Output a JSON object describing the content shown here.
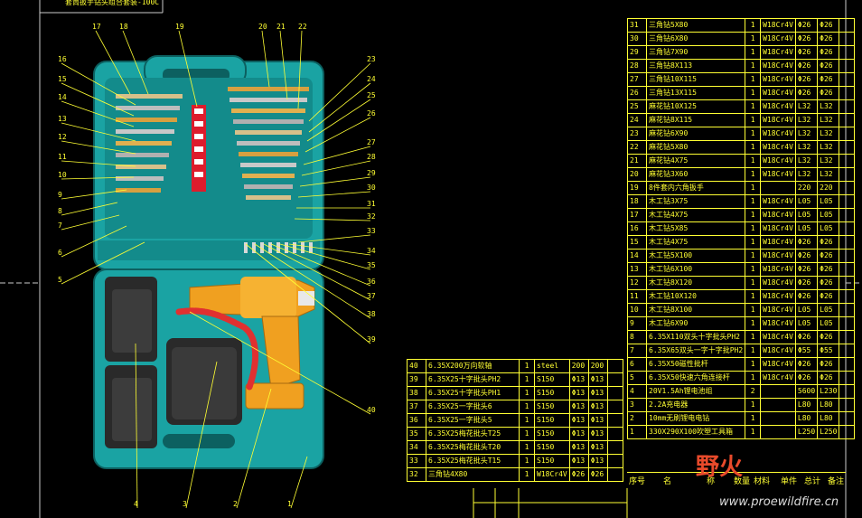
{
  "drawing_title_fragment": "套筒扳手钻头组合套装-100C",
  "callout_numbers": [
    "1",
    "2",
    "3",
    "4",
    "5",
    "6",
    "7",
    "8",
    "9",
    "10",
    "11",
    "12",
    "13",
    "14",
    "15",
    "16",
    "17",
    "18",
    "19",
    "20",
    "21",
    "22",
    "23",
    "24",
    "25",
    "26",
    "27",
    "28",
    "29",
    "30",
    "31",
    "32",
    "33",
    "34",
    "35",
    "36",
    "37",
    "38",
    "39",
    "40"
  ],
  "bom_right": [
    [
      "31",
      "三角钻5X80",
      "1",
      "W18Cr4V",
      "Φ26",
      "Φ26",
      ""
    ],
    [
      "30",
      "三角钻6X80",
      "1",
      "W18Cr4V",
      "Φ26",
      "Φ26",
      ""
    ],
    [
      "29",
      "三角钻7X90",
      "1",
      "W18Cr4V",
      "Φ26",
      "Φ26",
      ""
    ],
    [
      "28",
      "三角钻8X113",
      "1",
      "W18Cr4V",
      "Φ26",
      "Φ26",
      ""
    ],
    [
      "27",
      "三角钻10X115",
      "1",
      "W18Cr4V",
      "Φ26",
      "Φ26",
      ""
    ],
    [
      "26",
      "三角钻13X115",
      "1",
      "W18Cr4V",
      "Φ26",
      "Φ26",
      ""
    ],
    [
      "25",
      "麻花钻10X125",
      "1",
      "W18Cr4V",
      "L32",
      "L32",
      ""
    ],
    [
      "24",
      "麻花钻8X115",
      "1",
      "W18Cr4V",
      "L32",
      "L32",
      ""
    ],
    [
      "23",
      "麻花钻6X90",
      "1",
      "W18Cr4V",
      "L32",
      "L32",
      ""
    ],
    [
      "22",
      "麻花钻5X80",
      "1",
      "W18Cr4V",
      "L32",
      "L32",
      ""
    ],
    [
      "21",
      "麻花钻4X75",
      "1",
      "W18Cr4V",
      "L32",
      "L32",
      ""
    ],
    [
      "20",
      "麻花钻3X60",
      "1",
      "W18Cr4V",
      "L32",
      "L32",
      ""
    ],
    [
      "19",
      "8件套内六角扳手",
      "1",
      "",
      "220",
      "220",
      ""
    ],
    [
      "18",
      "木工钻3X75",
      "1",
      "W18Cr4V",
      "L05",
      "L05",
      ""
    ],
    [
      "17",
      "木工钻4X75",
      "1",
      "W18Cr4V",
      "L05",
      "L05",
      ""
    ],
    [
      "16",
      "木工钻5X85",
      "1",
      "W18Cr4V",
      "L05",
      "L05",
      ""
    ],
    [
      "15",
      "木工钻4X75",
      "1",
      "W18Cr4V",
      "Φ26",
      "Φ26",
      ""
    ],
    [
      "14",
      "木工钻5X100",
      "1",
      "W18Cr4V",
      "Φ26",
      "Φ26",
      ""
    ],
    [
      "13",
      "木工钻6X100",
      "1",
      "W18Cr4V",
      "Φ26",
      "Φ26",
      ""
    ],
    [
      "12",
      "木工钻8X120",
      "1",
      "W18Cr4V",
      "Φ26",
      "Φ26",
      ""
    ],
    [
      "11",
      "木工钻10X120",
      "1",
      "W18Cr4V",
      "Φ26",
      "Φ26",
      ""
    ],
    [
      "10",
      "木工钻8X100",
      "1",
      "W18Cr4V",
      "L05",
      "L05",
      ""
    ],
    [
      "9",
      "木工钻6X90",
      "1",
      "W18Cr4V",
      "L05",
      "L05",
      ""
    ],
    [
      "8",
      "6.35X110双头十字批头PH2",
      "1",
      "W18Cr4V",
      "Φ26",
      "Φ26",
      ""
    ],
    [
      "7",
      "6.35X65双头一字十字批PH2",
      "1",
      "W18Cr4V",
      "Φ55",
      "Φ55",
      ""
    ],
    [
      "6",
      "6.35X50磁性批杆",
      "1",
      "W18Cr4V",
      "Φ26",
      "Φ26",
      ""
    ],
    [
      "5",
      "6.35X50快速六角连接杆",
      "1",
      "W18Cr4V",
      "Φ26",
      "Φ26",
      ""
    ],
    [
      "4",
      "20V1.5Ah锂电池组",
      "2",
      "",
      "5600",
      "L230",
      ""
    ],
    [
      "3",
      "2.2A充电器",
      "1",
      "",
      "L80",
      "L80",
      ""
    ],
    [
      "2",
      "10mm无刷锂电电钻",
      "1",
      "",
      "L80",
      "L80",
      ""
    ],
    [
      "1",
      "330X290X100吹塑工具箱",
      "1",
      "",
      "L250",
      "L250",
      ""
    ]
  ],
  "bom_right_header": [
    "序号",
    "名",
    "称",
    "数量",
    "材料",
    "单件",
    "总计",
    "备注"
  ],
  "bom_left": [
    [
      "40",
      "6.35X200万向软轴",
      "1",
      "steel",
      "200",
      "200",
      ""
    ],
    [
      "39",
      "6.35X25十字批头PH2",
      "1",
      "S150",
      "Φ13",
      "Φ13",
      ""
    ],
    [
      "38",
      "6.35X25十字批头PH1",
      "1",
      "S150",
      "Φ13",
      "Φ13",
      ""
    ],
    [
      "37",
      "6.35X25一字批头6",
      "1",
      "S150",
      "Φ13",
      "Φ13",
      ""
    ],
    [
      "36",
      "6.35X25一字批头5",
      "1",
      "S150",
      "Φ13",
      "Φ13",
      ""
    ],
    [
      "35",
      "6.35X25梅花批头T25",
      "1",
      "S150",
      "Φ13",
      "Φ13",
      ""
    ],
    [
      "34",
      "6.35X25梅花批头T20",
      "1",
      "S150",
      "Φ13",
      "Φ13",
      ""
    ],
    [
      "33",
      "6.35X25梅花批头T15",
      "1",
      "S150",
      "Φ13",
      "Φ13",
      ""
    ],
    [
      "32",
      "三角钻4X80",
      "1",
      "W18Cr4V",
      "Φ26",
      "Φ26",
      ""
    ]
  ],
  "watermark_text": "野火",
  "watermark_url": "www.proewildfire.cn",
  "colors": {
    "background": "#000000",
    "annotation": "#ffff33",
    "case_teal": "#1aa3a3",
    "drill_orange": "#f0a020",
    "battery_dark": "#2a2a2a",
    "hose_red": "#e03030",
    "bit_red": "#dd1c2c"
  }
}
